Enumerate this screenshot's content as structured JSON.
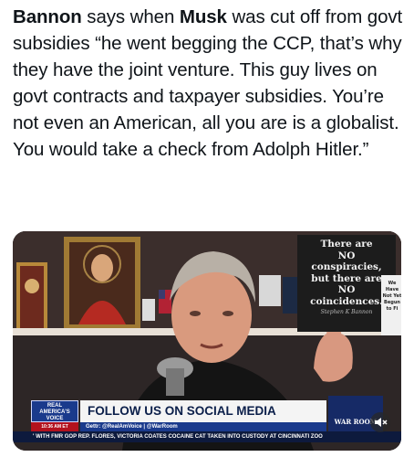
{
  "tweet": {
    "part1_bold": "Bannon",
    "part2": " says when ",
    "part3_bold": "Musk",
    "part4": " was cut off from govt subsidies “he went begging the CCP, that’s why they have the joint venture. This guy lives on govt contracts and taxpayer subsidies. You’re not even an American, all you are is a globalist. You would take a check from Adolph Hitler.”"
  },
  "video": {
    "sign": {
      "line1": "There are",
      "line2": "NO",
      "line3": "conspiracies,",
      "line4": "but there are",
      "line5": "NO",
      "line6": "coincidences.",
      "signature": "Stephen K Bannon"
    },
    "small_sign": "We Have Not Yet Begun to Fi",
    "chyron": {
      "brand": "REAL AMERICA'S VOICE",
      "headline": "FOLLOW US ON SOCIAL MEDIA",
      "time": "10:36 AM ET",
      "handles": "Gettr: @RealAmVoice | @WarRoom",
      "ticker": "' WITH FMR GOP REP. FLORES, VICTORIA COATES     COCAINE CAT TAKEN INTO CUSTODY AT CINCINNATI ZOO",
      "show_logo": "WAR ROOM"
    },
    "mute_icon": "speaker-muted-icon"
  }
}
